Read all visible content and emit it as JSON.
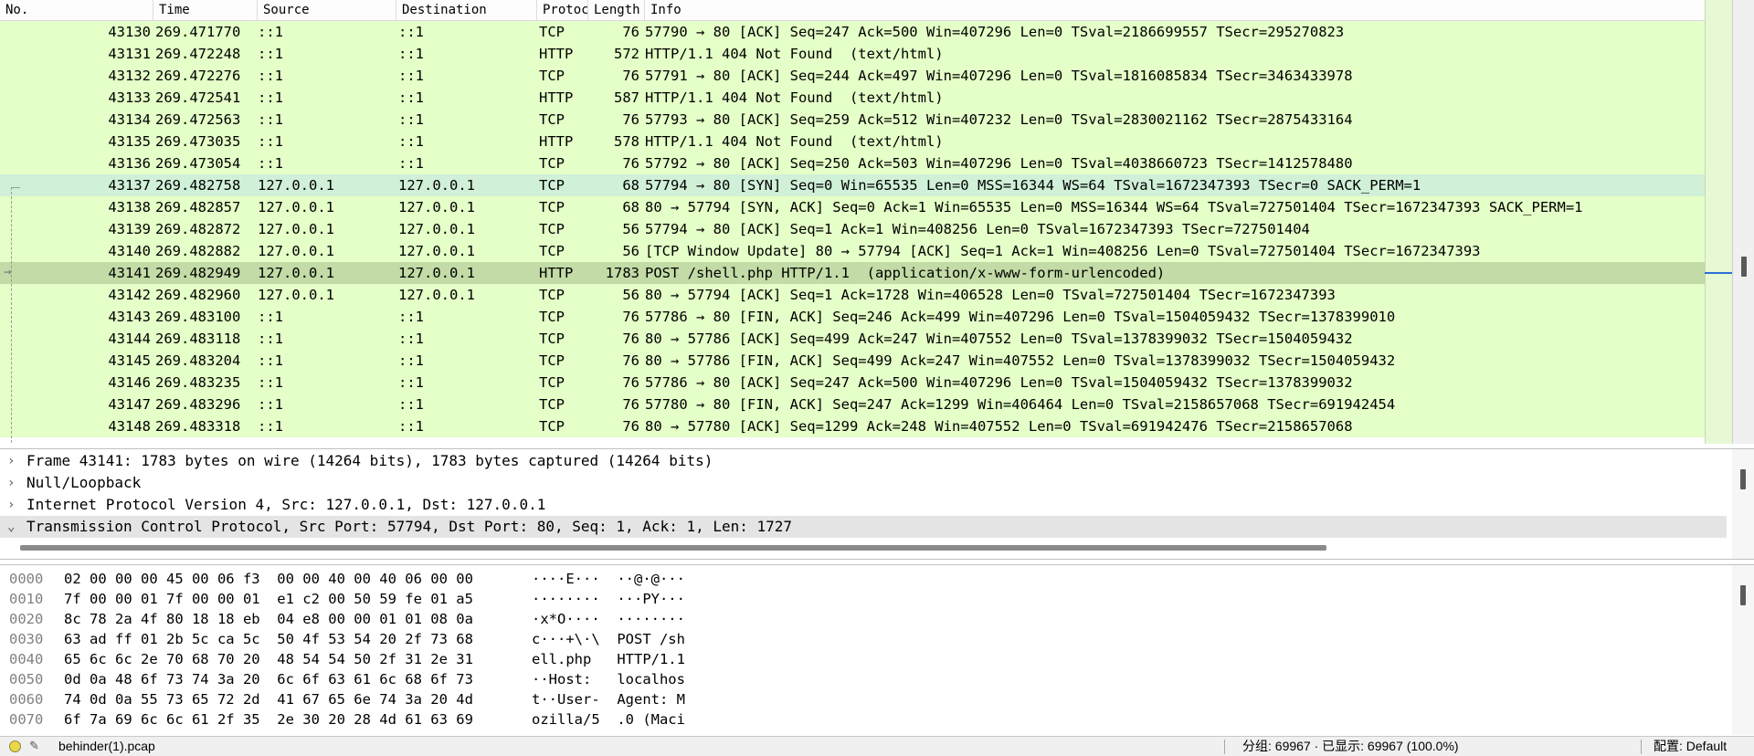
{
  "packet_list": {
    "columns": [
      "No.",
      "Time",
      "Source",
      "Destination",
      "Protoc",
      "Length",
      "Info"
    ],
    "rows": [
      {
        "no": "43130",
        "time": "269.471770",
        "src": "::1",
        "dst": "::1",
        "proto": "TCP",
        "len": "76",
        "info": "57790 → 80 [ACK] Seq=247 Ack=500 Win=407296 Len=0 TSval=2186699557 TSecr=295270823"
      },
      {
        "no": "43131",
        "time": "269.472248",
        "src": "::1",
        "dst": "::1",
        "proto": "HTTP",
        "len": "572",
        "info": "HTTP/1.1 404 Not Found  (text/html)"
      },
      {
        "no": "43132",
        "time": "269.472276",
        "src": "::1",
        "dst": "::1",
        "proto": "TCP",
        "len": "76",
        "info": "57791 → 80 [ACK] Seq=244 Ack=497 Win=407296 Len=0 TSval=1816085834 TSecr=3463433978"
      },
      {
        "no": "43133",
        "time": "269.472541",
        "src": "::1",
        "dst": "::1",
        "proto": "HTTP",
        "len": "587",
        "info": "HTTP/1.1 404 Not Found  (text/html)"
      },
      {
        "no": "43134",
        "time": "269.472563",
        "src": "::1",
        "dst": "::1",
        "proto": "TCP",
        "len": "76",
        "info": "57793 → 80 [ACK] Seq=259 Ack=512 Win=407232 Len=0 TSval=2830021162 TSecr=2875433164"
      },
      {
        "no": "43135",
        "time": "269.473035",
        "src": "::1",
        "dst": "::1",
        "proto": "HTTP",
        "len": "578",
        "info": "HTTP/1.1 404 Not Found  (text/html)"
      },
      {
        "no": "43136",
        "time": "269.473054",
        "src": "::1",
        "dst": "::1",
        "proto": "TCP",
        "len": "76",
        "info": "57792 → 80 [ACK] Seq=250 Ack=503 Win=407296 Len=0 TSval=4038660723 TSecr=1412578480"
      },
      {
        "no": "43137",
        "time": "269.482758",
        "src": "127.0.0.1",
        "dst": "127.0.0.1",
        "proto": "TCP",
        "len": "68",
        "info": "57794 → 80 [SYN] Seq=0 Win=65535 Len=0 MSS=16344 WS=64 TSval=1672347393 TSecr=0 SACK_PERM=1"
      },
      {
        "no": "43138",
        "time": "269.482857",
        "src": "127.0.0.1",
        "dst": "127.0.0.1",
        "proto": "TCP",
        "len": "68",
        "info": "80 → 57794 [SYN, ACK] Seq=0 Ack=1 Win=65535 Len=0 MSS=16344 WS=64 TSval=727501404 TSecr=1672347393 SACK_PERM=1"
      },
      {
        "no": "43139",
        "time": "269.482872",
        "src": "127.0.0.1",
        "dst": "127.0.0.1",
        "proto": "TCP",
        "len": "56",
        "info": "57794 → 80 [ACK] Seq=1 Ack=1 Win=408256 Len=0 TSval=1672347393 TSecr=727501404"
      },
      {
        "no": "43140",
        "time": "269.482882",
        "src": "127.0.0.1",
        "dst": "127.0.0.1",
        "proto": "TCP",
        "len": "56",
        "info": "[TCP Window Update] 80 → 57794 [ACK] Seq=1 Ack=1 Win=408256 Len=0 TSval=727501404 TSecr=1672347393"
      },
      {
        "no": "43141",
        "time": "269.482949",
        "src": "127.0.0.1",
        "dst": "127.0.0.1",
        "proto": "HTTP",
        "len": "1783",
        "info": "POST /shell.php HTTP/1.1  (application/x-www-form-urlencoded)"
      },
      {
        "no": "43142",
        "time": "269.482960",
        "src": "127.0.0.1",
        "dst": "127.0.0.1",
        "proto": "TCP",
        "len": "56",
        "info": "80 → 57794 [ACK] Seq=1 Ack=1728 Win=406528 Len=0 TSval=727501404 TSecr=1672347393"
      },
      {
        "no": "43143",
        "time": "269.483100",
        "src": "::1",
        "dst": "::1",
        "proto": "TCP",
        "len": "76",
        "info": "57786 → 80 [FIN, ACK] Seq=246 Ack=499 Win=407296 Len=0 TSval=1504059432 TSecr=1378399010"
      },
      {
        "no": "43144",
        "time": "269.483118",
        "src": "::1",
        "dst": "::1",
        "proto": "TCP",
        "len": "76",
        "info": "80 → 57786 [ACK] Seq=499 Ack=247 Win=407552 Len=0 TSval=1378399032 TSecr=1504059432"
      },
      {
        "no": "43145",
        "time": "269.483204",
        "src": "::1",
        "dst": "::1",
        "proto": "TCP",
        "len": "76",
        "info": "80 → 57786 [FIN, ACK] Seq=499 Ack=247 Win=407552 Len=0 TSval=1378399032 TSecr=1504059432"
      },
      {
        "no": "43146",
        "time": "269.483235",
        "src": "::1",
        "dst": "::1",
        "proto": "TCP",
        "len": "76",
        "info": "57786 → 80 [ACK] Seq=247 Ack=500 Win=407296 Len=0 TSval=1504059432 TSecr=1378399032"
      },
      {
        "no": "43147",
        "time": "269.483296",
        "src": "::1",
        "dst": "::1",
        "proto": "TCP",
        "len": "76",
        "info": "57780 → 80 [FIN, ACK] Seq=247 Ack=1299 Win=406464 Len=0 TSval=2158657068 TSecr=691942454"
      },
      {
        "no": "43148",
        "time": "269.483318",
        "src": "::1",
        "dst": "::1",
        "proto": "TCP",
        "len": "76",
        "info": "80 → 57780 [ACK] Seq=1299 Ack=248 Win=407552 Len=0 TSval=691942476 TSecr=2158657068"
      }
    ],
    "hover_row": 7,
    "selected_row": 11
  },
  "details": {
    "items": [
      {
        "chevron": "›",
        "text": "Frame 43141: 1783 bytes on wire (14264 bits), 1783 bytes captured (14264 bits)"
      },
      {
        "chevron": "›",
        "text": "Null/Loopback"
      },
      {
        "chevron": "›",
        "text": "Internet Protocol Version 4, Src: 127.0.0.1, Dst: 127.0.0.1"
      },
      {
        "chevron": "⌄",
        "text": "Transmission Control Protocol, Src Port: 57794, Dst Port: 80, Seq: 1, Ack: 1, Len: 1727"
      }
    ],
    "selected_item": 3
  },
  "bytes": {
    "rows": [
      {
        "offset": "0000",
        "hex": "02 00 00 00 45 00 06 f3  00 00 40 00 40 06 00 00",
        "ascii": "····E···  ··@·@···"
      },
      {
        "offset": "0010",
        "hex": "7f 00 00 01 7f 00 00 01  e1 c2 00 50 59 fe 01 a5",
        "ascii": "········  ···PY···"
      },
      {
        "offset": "0020",
        "hex": "8c 78 2a 4f 80 18 18 eb  04 e8 00 00 01 01 08 0a",
        "ascii": "·x*O····  ········"
      },
      {
        "offset": "0030",
        "hex": "63 ad ff 01 2b 5c ca 5c  50 4f 53 54 20 2f 73 68",
        "ascii": "c···+\\·\\  POST /sh"
      },
      {
        "offset": "0040",
        "hex": "65 6c 6c 2e 70 68 70 20  48 54 54 50 2f 31 2e 31",
        "ascii": "ell.php   HTTP/1.1"
      },
      {
        "offset": "0050",
        "hex": "0d 0a 48 6f 73 74 3a 20  6c 6f 63 61 6c 68 6f 73",
        "ascii": "··Host:   localhos"
      },
      {
        "offset": "0060",
        "hex": "74 0d 0a 55 73 65 72 2d  41 67 65 6e 74 3a 20 4d",
        "ascii": "t··User-  Agent: M"
      },
      {
        "offset": "0070",
        "hex": "6f 7a 69 6c 6c 61 2f 35  2e 30 20 28 4d 61 63 69",
        "ascii": "ozilla/5  .0 (Maci"
      }
    ]
  },
  "statusbar": {
    "file": "behinder(1).pcap",
    "stats": "分组: 69967 · 已显示: 69967 (100.0%)",
    "profile": "配置: Default"
  },
  "colors": {
    "row_bg": "#e4ffc7",
    "row_hover": "#d0f0d8",
    "row_selected": "#c3dba6",
    "marker_blue": "#2a6fd6"
  }
}
